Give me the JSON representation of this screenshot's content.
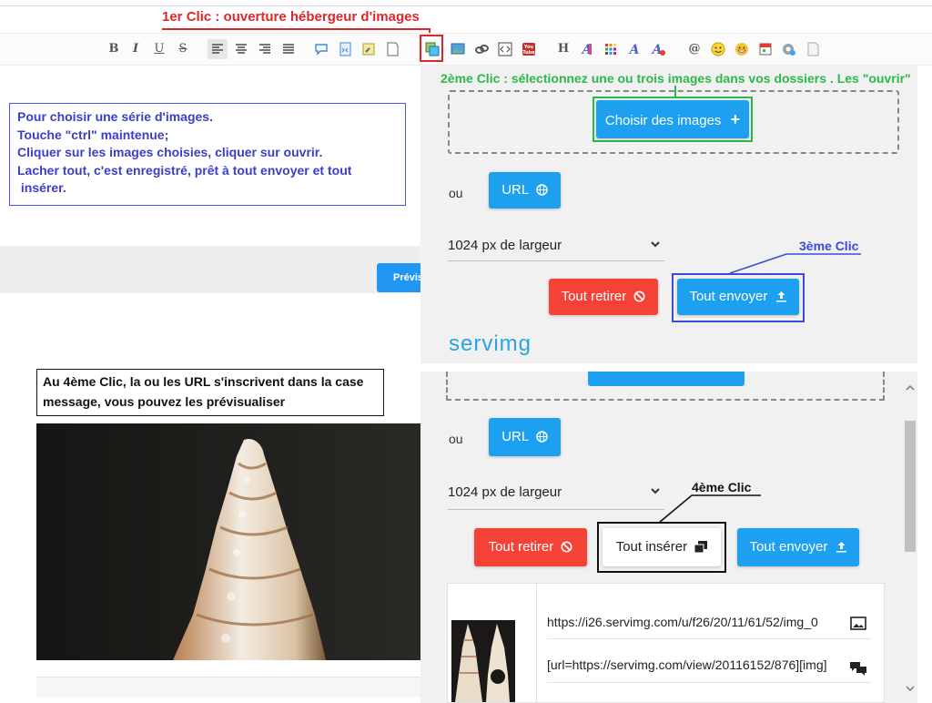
{
  "annotations": {
    "first_click": "1er Clic : ouverture hébergeur d'images",
    "second_click": "2ème Clic : sélectionnez une ou trois images dans vos dossiers . Les \"ouvrir\"",
    "third_click": "3ème Clic",
    "fourth_click": "4ème Clic"
  },
  "toolbar": {
    "bold": "B",
    "italic": "I",
    "underline": "U",
    "strike": "S",
    "headline": "H",
    "at": "@"
  },
  "editor": {
    "note_lines": [
      "Pour choisir une série d'images.",
      "Touche \"ctrl\" maintenue;",
      "Cliquer sur les images choisies, cliquer sur ouvrir.",
      "Lacher tout, c'est enregistré, prêt à tout envoyer et tout",
      " insérer."
    ],
    "preview_label": "Prévis"
  },
  "upload_panel": {
    "choose_images_label": "Choisir des images",
    "or_label": "ou",
    "url_label": "URL",
    "width_select": "1024 px de largeur",
    "remove_all_label": "Tout retirer",
    "send_all_label": "Tout envoyer",
    "brand": "servimg"
  },
  "upload_panel_2": {
    "or_label": "ou",
    "url_label": "URL",
    "width_select": "1024 px de largeur",
    "remove_all_label": "Tout retirer",
    "insert_all_label": "Tout insérer",
    "send_all_label": "Tout envoyer",
    "image_url": "https://i26.servimg.com/u/f26/20/11/61/52/img_0",
    "bbcode_url": "[url=https://servimg.com/view/20116152/876][img]"
  },
  "caption": {
    "text": "Au 4ème Clic, la ou les URL s'inscrivent dans la case message, vous pouvez les prévisualiser"
  },
  "colors": {
    "accent_blue": "#1ea0f0",
    "danger_red": "#f44336",
    "annotation_red": "#e0262b",
    "annotation_green": "#2db84d",
    "annotation_blue": "#3b4cd8"
  }
}
